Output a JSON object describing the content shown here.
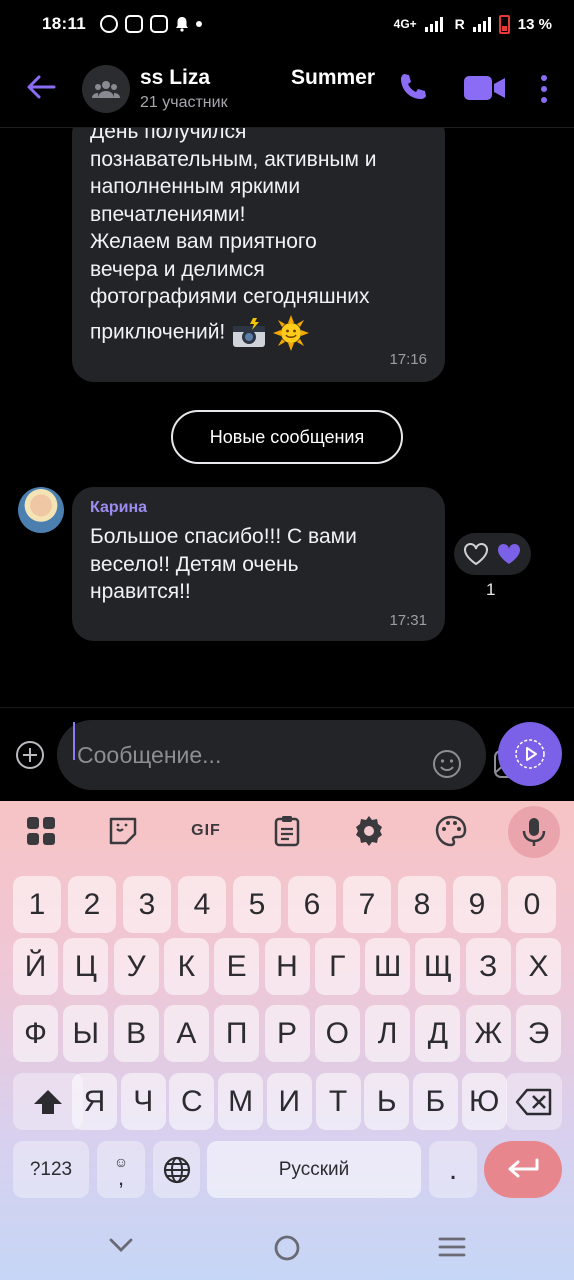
{
  "status_bar": {
    "time": "18:11",
    "network": "4G+",
    "roaming": "R",
    "battery_percent": "13 %"
  },
  "header": {
    "title": "ss Liza",
    "title_suffix": "Summer",
    "subtitle": "21 участник"
  },
  "messages": [
    {
      "text": "День получился познавательным, активным и наполненным яркими впечатлениями! Желаем вам приятного вечера и делимся фотографиями сегодняшних приключений!",
      "lines": [
        "День получился",
        "познавательным, активным и",
        "наполненным яркими",
        "впечатлениями!",
        "Желаем вам приятного",
        "вечера и делимся",
        "фотографиями сегодняшних",
        "приключений!"
      ],
      "emojis": [
        "camera-flash-emoji",
        "sun-emoji"
      ],
      "time": "17:16"
    },
    {
      "sender": "Карина",
      "lines": [
        "Большое спасибо!!! С вами",
        "весело!! Детям очень",
        "нравится!!"
      ],
      "time": "17:31",
      "reaction_count": "1"
    }
  ],
  "new_messages_label": "Новые сообщения",
  "composer": {
    "placeholder": "Сообщение..."
  },
  "keyboard": {
    "toolbar": [
      "apps-icon",
      "sticker-icon",
      "GIF",
      "clipboard-icon",
      "settings-icon",
      "palette-icon",
      "mic-icon"
    ],
    "gif_label": "GIF",
    "row_numbers": [
      "1",
      "2",
      "3",
      "4",
      "5",
      "6",
      "7",
      "8",
      "9",
      "0"
    ],
    "row1": [
      "Й",
      "Ц",
      "У",
      "К",
      "Е",
      "Н",
      "Г",
      "Ш",
      "Щ",
      "З",
      "Х"
    ],
    "row2": [
      "Ф",
      "Ы",
      "В",
      "А",
      "П",
      "Р",
      "О",
      "Л",
      "Д",
      "Ж",
      "Э"
    ],
    "row3": [
      "Я",
      "Ч",
      "С",
      "М",
      "И",
      "Т",
      "Ь",
      "Б",
      "Ю"
    ],
    "symbols_label": "?123",
    "comma_label": ",",
    "space_label": "Русский",
    "period_label": "."
  },
  "colors": {
    "accent": "#7b61e8",
    "bubble": "#232428",
    "sender_name": "#9d8cf0",
    "keyboard_enter": "#e8868e"
  }
}
